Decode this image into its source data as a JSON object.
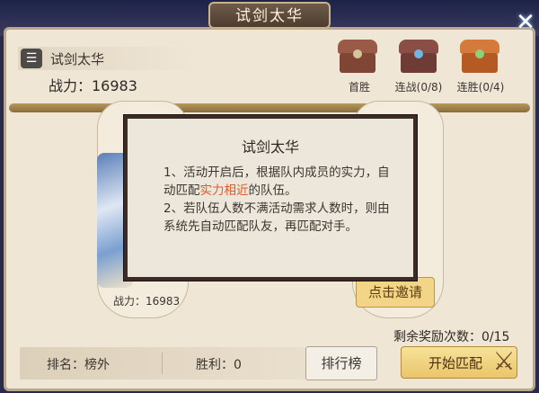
{
  "window": {
    "title": "试剑太华"
  },
  "player": {
    "name": "试剑太华",
    "power_label": "战力：16983"
  },
  "chests": [
    {
      "label": "首胜",
      "color_lid": "#9a5a48",
      "color_body": "#7f4535",
      "icon": "chest-icon"
    },
    {
      "label": "连战(0/8)",
      "color_lid": "#8a4e45",
      "color_body": "#6e3c34",
      "icon": "chest-icon"
    },
    {
      "label": "连胜(0/4)",
      "color_lid": "#d47a3a",
      "color_body": "#b65a24",
      "icon": "chest-icon"
    }
  ],
  "left_card": {
    "power": "战力：16983"
  },
  "right_card": {
    "invite_label": "点击邀请"
  },
  "dialog": {
    "title": "试剑太华",
    "line1_a": "1、活动开启后，根据队内成员的实力，自动匹配",
    "line1_hl": "实力相近",
    "line1_b": "的队伍。",
    "line2": "2、若队伍人数不满活动需求人数时，则由系统先自动匹配队友，再匹配对手。"
  },
  "remaining_rewards": "剩余奖励次数：0/15",
  "bottom": {
    "rank": "排名：榜外",
    "wins": "胜利：0",
    "leaderboard_button": "排行榜",
    "start_button": "开始匹配"
  },
  "colors": {
    "highlight": "#e05a2a",
    "dialog_border": "#3d2b26"
  }
}
